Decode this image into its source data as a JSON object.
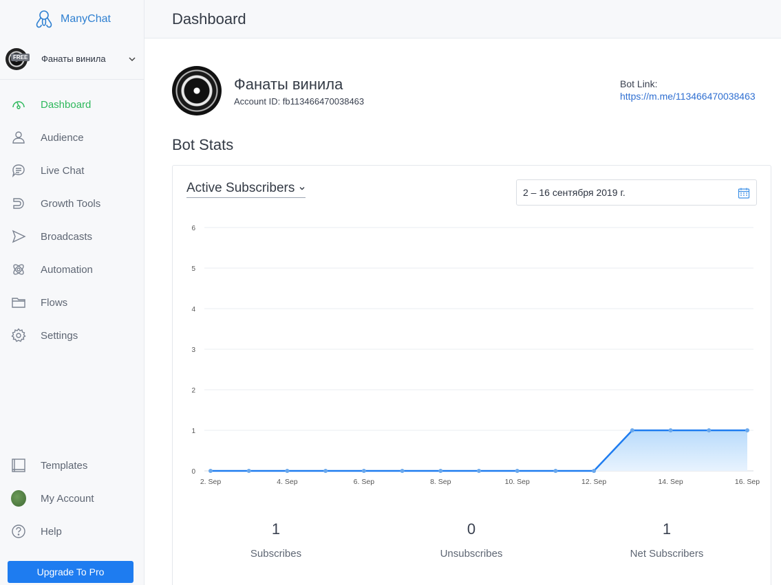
{
  "app": {
    "logo_text": "ManyChat"
  },
  "account": {
    "name": "Фанаты винила",
    "badge": "FREE"
  },
  "sidebar": {
    "items": [
      {
        "label": "Dashboard",
        "icon": "dashboard-icon",
        "active": true
      },
      {
        "label": "Audience",
        "icon": "user-icon"
      },
      {
        "label": "Live Chat",
        "icon": "chat-icon"
      },
      {
        "label": "Growth Tools",
        "icon": "magnet-icon"
      },
      {
        "label": "Broadcasts",
        "icon": "send-icon"
      },
      {
        "label": "Automation",
        "icon": "atom-icon"
      },
      {
        "label": "Flows",
        "icon": "folder-icon"
      },
      {
        "label": "Settings",
        "icon": "gear-icon"
      }
    ],
    "bottom_items": [
      {
        "label": "Templates",
        "icon": "templates-icon"
      },
      {
        "label": "My Account",
        "icon": "avatar"
      },
      {
        "label": "Help",
        "icon": "help-icon"
      }
    ],
    "upgrade_label": "Upgrade To Pro"
  },
  "header": {
    "title": "Dashboard"
  },
  "bot": {
    "name": "Фанаты винила",
    "account_id": "Account ID: fb113466470038463",
    "link_label": "Bot Link:",
    "link_url": "https://m.me/113466470038463"
  },
  "stats_section": {
    "title": "Bot Stats",
    "metric": "Active Subscribers",
    "date_range": "2 – 16 сентября 2019 г."
  },
  "chart_data": {
    "type": "area",
    "x": [
      "2. Sep",
      "3. Sep",
      "4. Sep",
      "5. Sep",
      "6. Sep",
      "7. Sep",
      "8. Sep",
      "9. Sep",
      "10. Sep",
      "11. Sep",
      "12. Sep",
      "13. Sep",
      "14. Sep",
      "15. Sep",
      "16. Sep"
    ],
    "x_tick_labels": [
      "2. Sep",
      "4. Sep",
      "6. Sep",
      "8. Sep",
      "10. Sep",
      "12. Sep",
      "14. Sep",
      "16. Sep"
    ],
    "series": [
      {
        "values": [
          0,
          0,
          0,
          0,
          0,
          0,
          0,
          0,
          0,
          0,
          0,
          1,
          1,
          1,
          1
        ]
      }
    ],
    "ylim": [
      0,
      6
    ],
    "y_ticks": [
      0,
      1,
      2,
      3,
      4,
      5,
      6
    ],
    "grid": true,
    "line_color": "#1e7cf0",
    "fill_color": "#cfe5fb"
  },
  "summary": [
    {
      "value": "1",
      "label": "Subscribes"
    },
    {
      "value": "0",
      "label": "Unsubscribes"
    },
    {
      "value": "1",
      "label": "Net Subscribers"
    }
  ],
  "colors": {
    "accent": "#1e7cf0",
    "active_nav": "#2eb85c",
    "link": "#2f6fd1"
  }
}
